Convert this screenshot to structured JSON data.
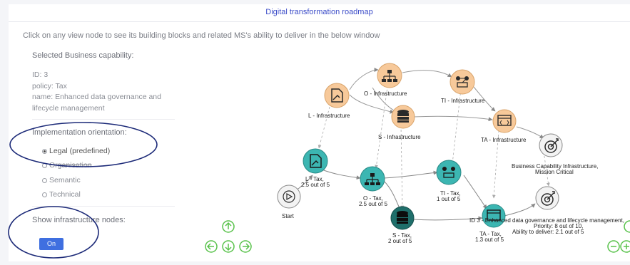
{
  "header": {
    "title": "Digital transformation roadmap"
  },
  "instruction": "Click on any view node to see its building blocks and related MS's ability to deliver in the below window",
  "selected": {
    "title": "Selected Business capability:",
    "id": "ID: 3",
    "policy": "policy: Tax",
    "name_line1": "name: Enhanced data governance and",
    "name_line2": "lifecycle management"
  },
  "orientation": {
    "title": "Implementation orientation:",
    "options": [
      {
        "label": "Legal (predefined)",
        "checked": true
      },
      {
        "label": "Organisation",
        "checked": false
      },
      {
        "label": "Semantic",
        "checked": false
      },
      {
        "label": "Technical",
        "checked": false
      }
    ]
  },
  "infra_toggle": {
    "title": "Show infrastructure nodes:",
    "value": "On"
  },
  "graph": {
    "nodes": {
      "l_infra": "L - Infrastructure",
      "o_infra": "O - Infrastructure",
      "ti_infra": "TI - Infrastructure",
      "s_infra": "S - Infrastructure",
      "ta_infra": "TA - Infrastructure",
      "bci_line1": "Business Capability Infrastructure,",
      "bci_line2": "Mission Critical",
      "l_tax_line1": "L - Tax,",
      "l_tax_line2": "2.5 out of 5",
      "o_tax_line1": "O - Tax,",
      "o_tax_line2": "2.5 out of 5",
      "ti_tax_line1": "TI - Tax,",
      "ti_tax_line2": "1 out of 5",
      "s_tax_line1": "S - Tax,",
      "s_tax_line2": "2 out of 5",
      "ta_tax_line1": "TA - Tax,",
      "ta_tax_line2": "1.3 out of 5",
      "start": "Start",
      "id3_line1": "ID 3 - Enhanced data governance and lifecycle management,",
      "id3_line2": "Priority: 8 out of 10,",
      "id3_line3": "Ability to deliver: 2.1 out of 5"
    }
  },
  "colors": {
    "accent": "#3f6fe0",
    "infra_node": "#f7c99a",
    "tax_node": "#3cb6b2",
    "tax_node_dark": "#1f6f6b",
    "nav_green": "#58c24a",
    "annotation": "#1c2a78"
  },
  "icons": [
    "document-icon",
    "org-chart-icon",
    "network-icon",
    "database-icon",
    "code-window-icon",
    "target-icon",
    "play-icon",
    "arrow-up-icon",
    "arrow-left-icon",
    "arrow-down-icon",
    "arrow-right-icon",
    "zoom-out-icon",
    "zoom-in-icon"
  ]
}
